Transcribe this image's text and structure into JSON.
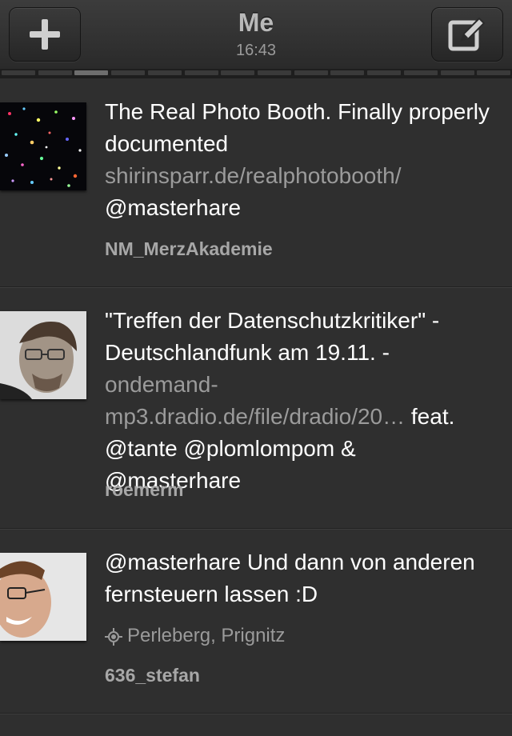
{
  "header": {
    "title": "Me",
    "time": "16:43",
    "add_icon": "plus-icon",
    "compose_icon": "compose-icon"
  },
  "pager": {
    "count": 14,
    "active_index": 2
  },
  "tweets": [
    {
      "text_before": "The Real Photo Booth. Finally properly documented",
      "link": "shirinsparr.de/realphotobooth/",
      "text_after": "@masterhare",
      "author": "NM_MerzAkademie"
    },
    {
      "text_before": "\"Treffen der Datenschutzkritiker\" - Deutschlandfunk am 19.11. -",
      "link": "ondemand-mp3.dradio.de/file/dradio/20…",
      "text_after": " feat. @tante @plomlompom & @masterhare",
      "author": "roemerm"
    },
    {
      "text_before": "@masterhare Und dann von anderen fernsteuern lassen :D",
      "location": "Perleberg, Prignitz",
      "author": "636_stefan"
    }
  ],
  "colors": {
    "background": "#2f2f2f",
    "link": "#9b9b9b",
    "author": "#a7a7a7"
  }
}
